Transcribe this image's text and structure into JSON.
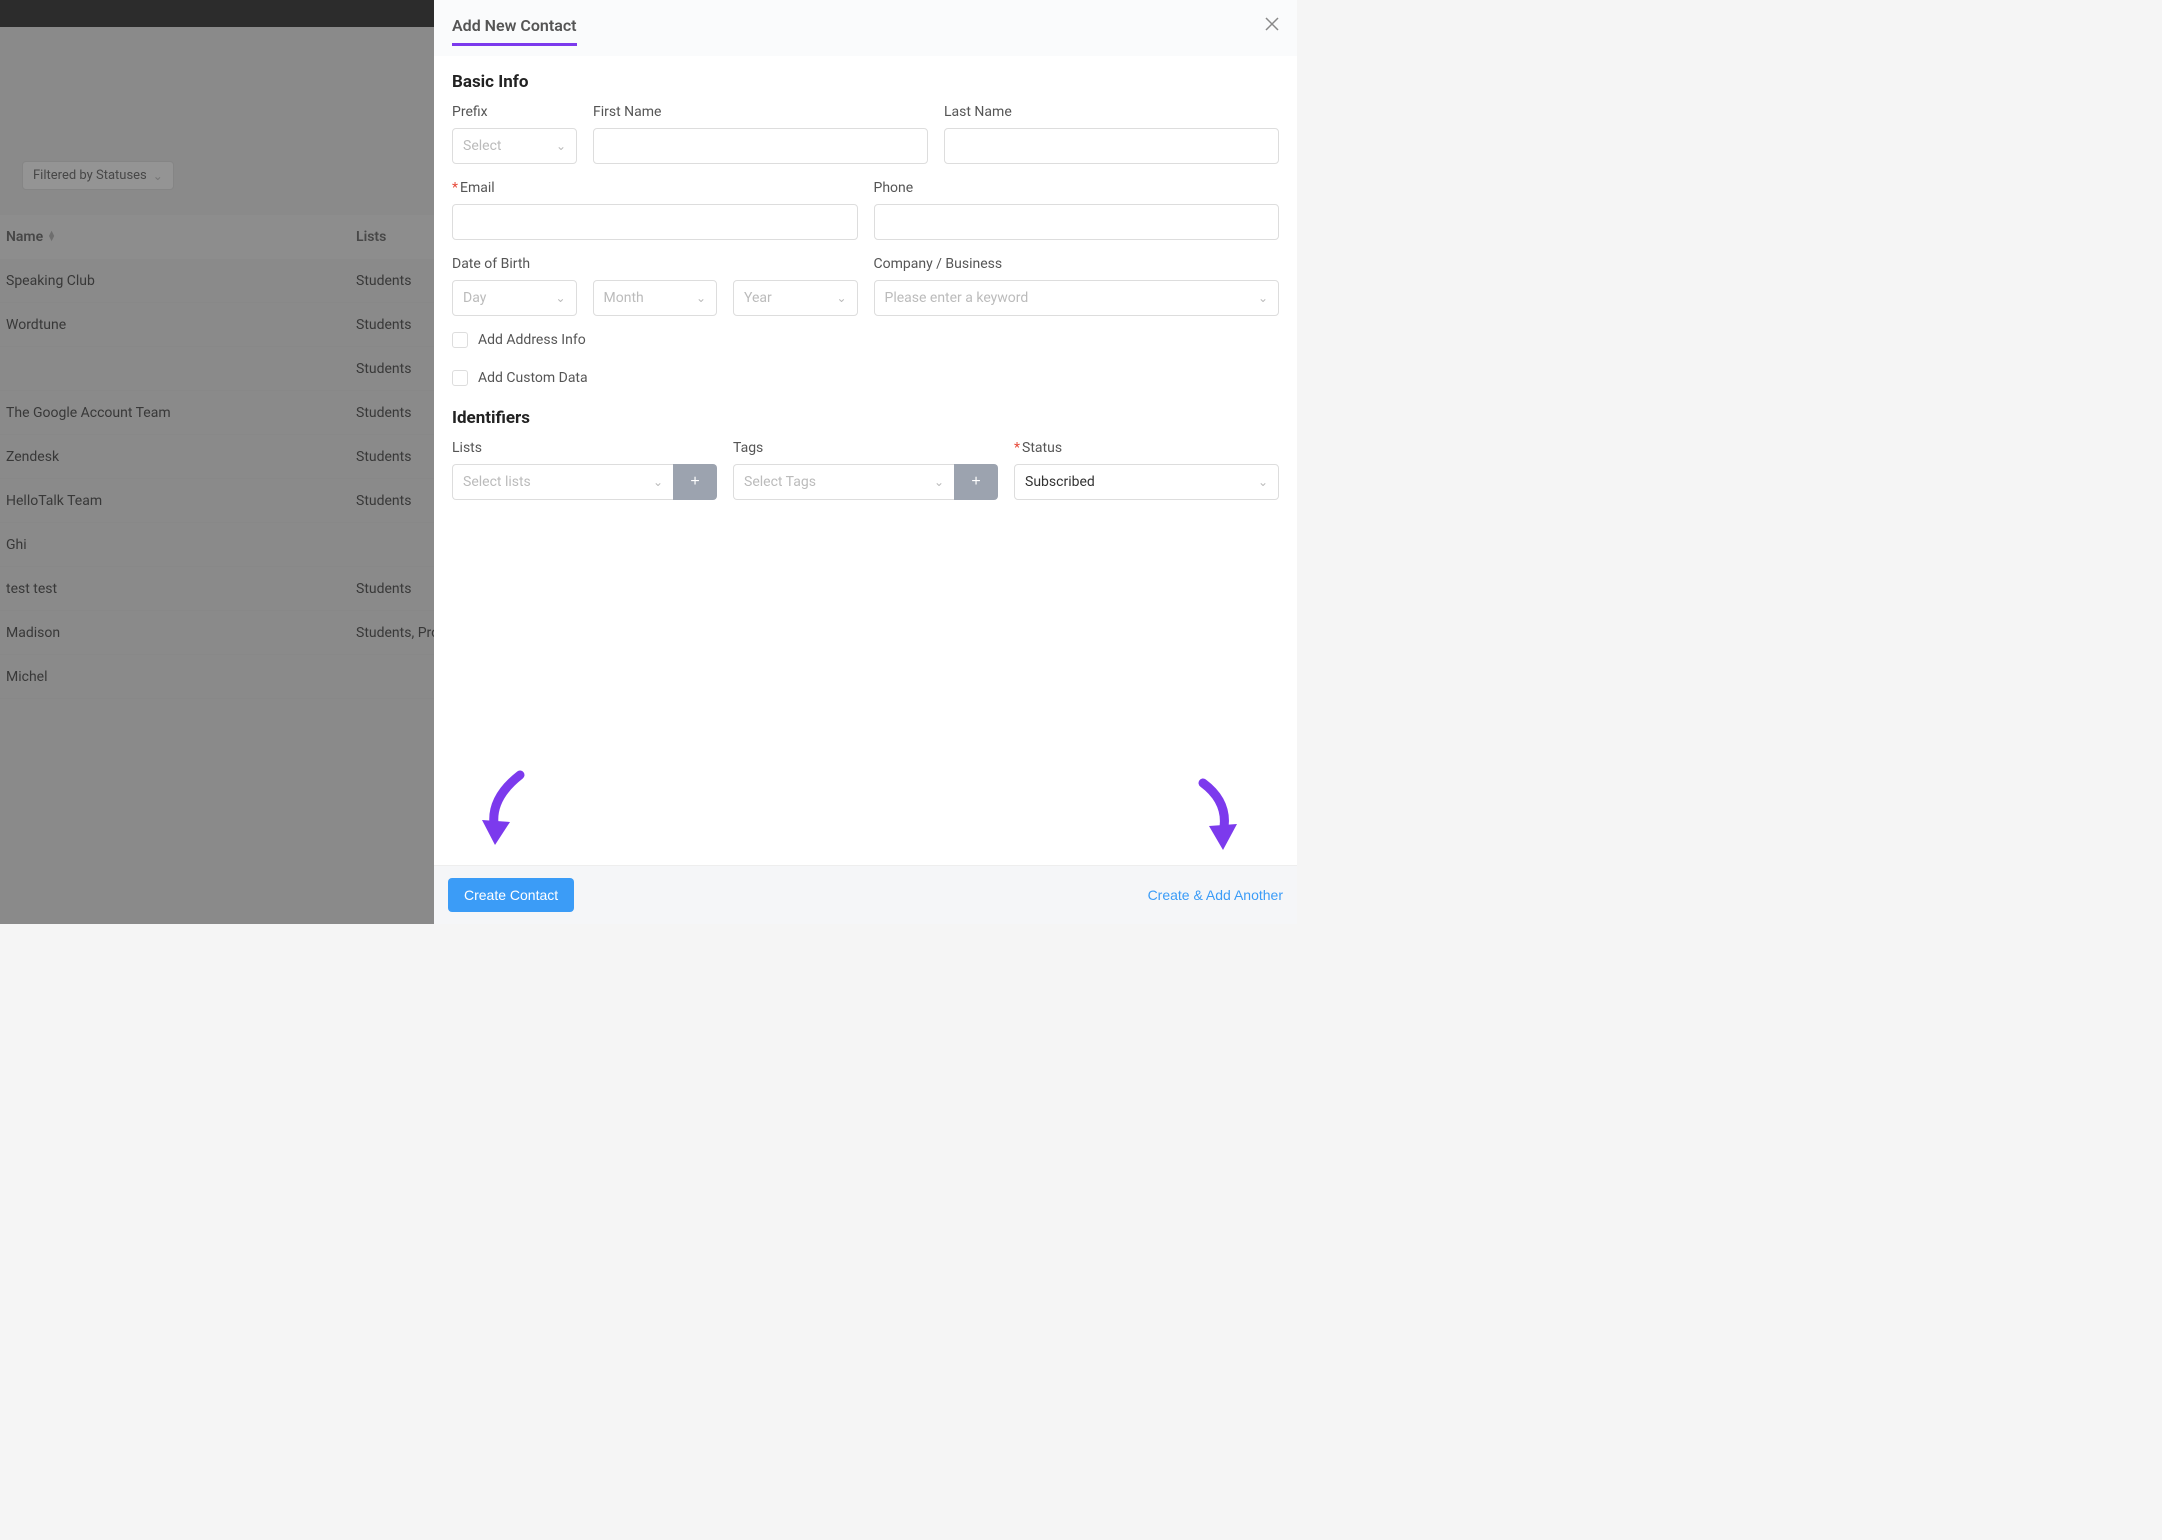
{
  "filter": {
    "label": "Filtered by Statuses"
  },
  "table": {
    "headers": {
      "name": "Name",
      "lists": "Lists"
    },
    "rows": [
      {
        "name": "Speaking Club",
        "lists": "Students"
      },
      {
        "name": "Wordtune",
        "lists": "Students"
      },
      {
        "name": "",
        "lists": "Students"
      },
      {
        "name": "The Google Account Team",
        "lists": "Students"
      },
      {
        "name": "Zendesk",
        "lists": "Students"
      },
      {
        "name": "HelloTalk Team",
        "lists": "Students"
      },
      {
        "name": "Ghi",
        "lists": ""
      },
      {
        "name": "test test",
        "lists": "Students"
      },
      {
        "name": "Madison",
        "lists": "Students, Pro"
      },
      {
        "name": "Michel",
        "lists": ""
      }
    ]
  },
  "modal": {
    "title": "Add New Contact",
    "sections": {
      "basic": "Basic Info",
      "identifiers": "Identifiers"
    },
    "labels": {
      "prefix": "Prefix",
      "firstName": "First Name",
      "lastName": "Last Name",
      "email": "Email",
      "phone": "Phone",
      "dob": "Date of Birth",
      "company": "Company / Business",
      "lists": "Lists",
      "tags": "Tags",
      "status": "Status",
      "addAddress": "Add Address Info",
      "addCustom": "Add Custom Data"
    },
    "placeholders": {
      "prefix": "Select",
      "day": "Day",
      "month": "Month",
      "year": "Year",
      "company": "Please enter a keyword",
      "lists": "Select lists",
      "tags": "Select Tags"
    },
    "values": {
      "status": "Subscribed"
    },
    "buttons": {
      "create": "Create Contact",
      "createAnother": "Create & Add Another",
      "plus": "+"
    }
  }
}
